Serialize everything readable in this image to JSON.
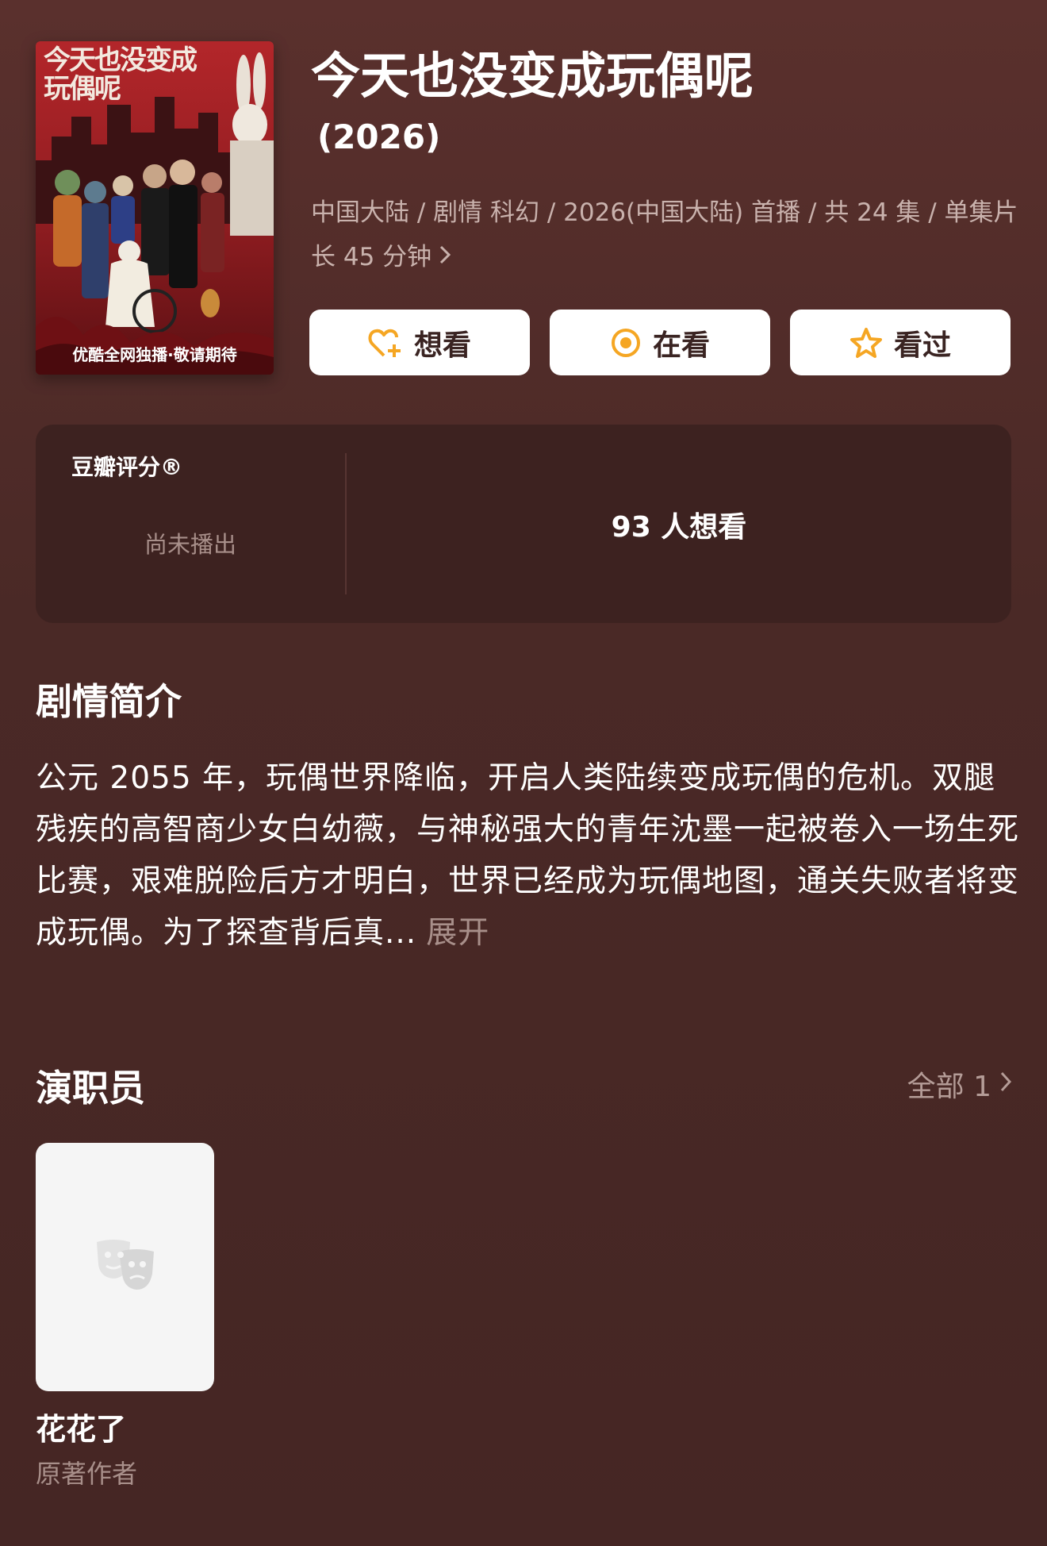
{
  "poster": {
    "title_art": "今天也没变成玩偶呢",
    "caption": "优酷全网独播·敬请期待"
  },
  "header": {
    "title": "今天也没变成玩偶呢",
    "year": "(2026)",
    "meta": "中国大陆 / 剧情 科幻 / 2026(中国大陆) 首播 / 共 24 集 / 单集片长 45 分钟"
  },
  "actions": {
    "want": "想看",
    "watching": "在看",
    "watched": "看过"
  },
  "rating": {
    "label": "豆瓣评分®",
    "status": "尚未播出",
    "want_count": "93 人想看"
  },
  "synopsis": {
    "heading": "剧情简介",
    "text": "公元 2055 年，玩偶世界降临，开启人类陆续变成玩偶的危机。双腿残疾的高智商少女白幼薇，与神秘强大的青年沈墨一起被卷入一场生死比赛，艰难脱险后方才明白，世界已经成为玩偶地图，通关失败者将变成玩偶。为了探查背后真...",
    "expand": "展开"
  },
  "cast": {
    "heading": "演职员",
    "see_all": "全部 1",
    "members": [
      {
        "name": "花花了",
        "role": "原著作者",
        "avatar_icon": "theater-mask-icon"
      }
    ]
  },
  "colors": {
    "background": "#4a2926",
    "card": "#3d2220",
    "muted_text": "#a88f8a",
    "accent": "#f5a623"
  }
}
